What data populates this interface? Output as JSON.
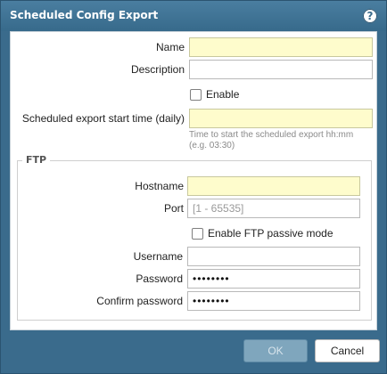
{
  "dialog": {
    "title": "Scheduled Config Export",
    "help_icon_char": "?"
  },
  "form": {
    "name_label": "Name",
    "name_value": "",
    "description_label": "Description",
    "description_value": "",
    "enable_label": "Enable",
    "enable_checked": false,
    "start_time_label": "Scheduled export start time (daily)",
    "start_time_value": "",
    "start_time_hint": "Time to start the scheduled export hh:mm (e.g. 03:30)"
  },
  "ftp": {
    "legend": "FTP",
    "hostname_label": "Hostname",
    "hostname_value": "",
    "port_label": "Port",
    "port_placeholder": "[1 - 65535]",
    "passive_label": "Enable FTP passive mode",
    "passive_checked": false,
    "username_label": "Username",
    "username_value": "",
    "password_label": "Password",
    "password_value": "••••••••",
    "confirm_label": "Confirm password",
    "confirm_value": "••••••••"
  },
  "buttons": {
    "ok": "OK",
    "cancel": "Cancel"
  },
  "colors": {
    "titlebar": "#3a6b8c",
    "required_field": "#fefccc",
    "ok_button": "#7fa6bd"
  }
}
